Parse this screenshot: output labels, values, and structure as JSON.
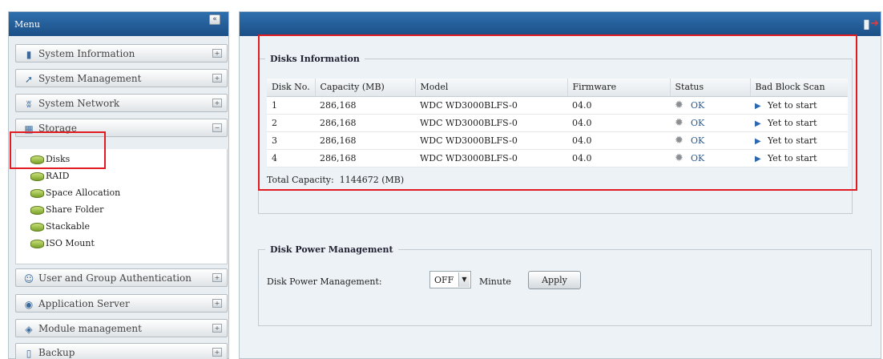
{
  "sidebar": {
    "title": "Menu",
    "collapse_glyph": "«",
    "expand_glyph": "+",
    "items": [
      {
        "label": "System Information",
        "icon": "monitor-icon",
        "glyph": "▮"
      },
      {
        "label": "System Management",
        "icon": "wrench-icon",
        "glyph": "➚"
      },
      {
        "label": "System Network",
        "icon": "network-icon",
        "glyph": "ʬ"
      },
      {
        "label": "Storage",
        "icon": "storage-icon",
        "glyph": "▦",
        "expanded": true,
        "expand_glyph": "−"
      },
      {
        "label": "User and Group Authentication",
        "icon": "users-icon",
        "glyph": "☺"
      },
      {
        "label": "Application Server",
        "icon": "server-icon",
        "glyph": "◉"
      },
      {
        "label": "Module management",
        "icon": "module-icon",
        "glyph": "◈"
      },
      {
        "label": "Backup",
        "icon": "backup-icon",
        "glyph": "▯"
      }
    ],
    "storage_subitems": [
      "Disks",
      "RAID",
      "Space Allocation",
      "Share Folder",
      "Stackable",
      "ISO Mount"
    ]
  },
  "disks_info": {
    "legend": "Disks Information",
    "columns": [
      "Disk No.",
      "Capacity (MB)",
      "Model",
      "Firmware",
      "Status",
      "Bad Block Scan"
    ],
    "rows": [
      {
        "no": "1",
        "capacity": "286,168",
        "model": "WDC WD3000BLFS-0",
        "firmware": "04.0",
        "status": "OK",
        "scan": "Yet to start"
      },
      {
        "no": "2",
        "capacity": "286,168",
        "model": "WDC WD3000BLFS-0",
        "firmware": "04.0",
        "status": "OK",
        "scan": "Yet to start"
      },
      {
        "no": "3",
        "capacity": "286,168",
        "model": "WDC WD3000BLFS-0",
        "firmware": "04.0",
        "status": "OK",
        "scan": "Yet to start"
      },
      {
        "no": "4",
        "capacity": "286,168",
        "model": "WDC WD3000BLFS-0",
        "firmware": "04.0",
        "status": "OK",
        "scan": "Yet to start"
      }
    ],
    "total_label": "Total Capacity:",
    "total_value": "1144672 (MB)"
  },
  "power_mgmt": {
    "legend": "Disk Power Management",
    "label": "Disk Power Management:",
    "selected": "OFF",
    "unit": "Minute",
    "apply_label": "Apply"
  },
  "colors": {
    "header_blue": "#1b4f86",
    "highlight_red": "#e01b22",
    "status_ok": "#2a5d94"
  }
}
